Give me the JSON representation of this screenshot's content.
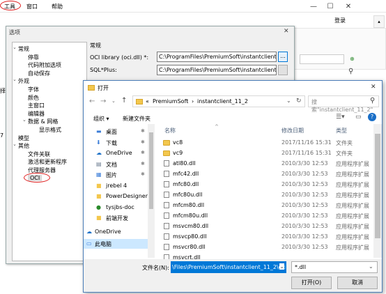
{
  "app": {
    "menu": [
      "工具",
      "窗口",
      "帮助"
    ],
    "login": "登录"
  },
  "options": {
    "title": "选项",
    "close": "✕",
    "section_title": "常规",
    "oci_label": "OCI library (oci.dll) *:",
    "oci_value": "C:\\ProgramFiles\\PremiumSoft\\instantclient_11",
    "sqlplus_label": "SQL*Plus:",
    "sqlplus_value": "C:\\ProgramFiles\\PremiumSoft\\instantclient_11_2",
    "browse": "...",
    "tree": [
      {
        "label": "常规",
        "level": 0,
        "expander": "⌄"
      },
      {
        "label": "停靠",
        "level": 1
      },
      {
        "label": "代码附加选项",
        "level": 1
      },
      {
        "label": "自动保存",
        "level": 1
      },
      {
        "label": "外观",
        "level": 0,
        "expander": "⌄"
      },
      {
        "label": "字体",
        "level": 1
      },
      {
        "label": "颜色",
        "level": 1
      },
      {
        "label": "主窗口",
        "level": 1
      },
      {
        "label": "编辑器",
        "level": 1
      },
      {
        "label": "数据 & 网格",
        "level": 1,
        "expander": "⌄"
      },
      {
        "label": "显示格式",
        "level": 2
      },
      {
        "label": "模型",
        "level": 0
      },
      {
        "label": "其他",
        "level": 0,
        "expander": "⌄"
      },
      {
        "label": "文件关联",
        "level": 1
      },
      {
        "label": "激活和更新程序",
        "level": 1
      },
      {
        "label": "代理服务器",
        "level": 1
      },
      {
        "label": "OCI",
        "level": 1,
        "selected": true
      }
    ]
  },
  "file_dialog": {
    "title": "打开",
    "close": "✕",
    "path": [
      "«",
      "PremiumSoft",
      "›",
      "instantclient_11_2"
    ],
    "search_placeholder": "搜索\"instantclient_11_2\"",
    "toolbar": {
      "organize": "组织 ▾",
      "new_folder": "新建文件夹"
    },
    "nav_items": [
      {
        "label": "桌面",
        "icon": "desktop-icon",
        "pinned": true
      },
      {
        "label": "下载",
        "icon": "download-icon",
        "pinned": true
      },
      {
        "label": "OneDrive",
        "icon": "onedrive-icon",
        "pinned": true
      },
      {
        "label": "文档",
        "icon": "documents-icon",
        "pinned": true
      },
      {
        "label": "图片",
        "icon": "pictures-icon",
        "pinned": true
      },
      {
        "label": "jrebel 4",
        "icon": "folder-icon"
      },
      {
        "label": "PowerDesigner",
        "icon": "folder-icon"
      },
      {
        "label": "tysjbs-doc",
        "icon": "app-icon"
      },
      {
        "label": "前端开发",
        "icon": "folder-icon"
      },
      {
        "label": "OneDrive",
        "icon": "onedrive-icon"
      },
      {
        "label": "此电脑",
        "icon": "pc-icon",
        "selected": true
      }
    ],
    "columns": {
      "name": "名称",
      "date": "修改日期",
      "type": "类型"
    },
    "files": [
      {
        "name": "vc8",
        "date": "2017/11/16 15:31",
        "type": "文件夹",
        "folder": true
      },
      {
        "name": "vc9",
        "date": "2017/11/16 15:31",
        "type": "文件夹",
        "folder": true
      },
      {
        "name": "atl80.dll",
        "date": "2010/3/30 12:53",
        "type": "应用程序扩展"
      },
      {
        "name": "mfc42.dll",
        "date": "2010/3/30 12:53",
        "type": "应用程序扩展"
      },
      {
        "name": "mfc80.dll",
        "date": "2010/3/30 12:53",
        "type": "应用程序扩展"
      },
      {
        "name": "mfc80u.dll",
        "date": "2010/3/30 12:53",
        "type": "应用程序扩展"
      },
      {
        "name": "mfcm80.dll",
        "date": "2010/3/30 12:53",
        "type": "应用程序扩展"
      },
      {
        "name": "mfcm80u.dll",
        "date": "2010/3/30 12:53",
        "type": "应用程序扩展"
      },
      {
        "name": "msvcm80.dll",
        "date": "2010/3/30 12:53",
        "type": "应用程序扩展"
      },
      {
        "name": "msvcp80.dll",
        "date": "2010/3/30 12:53",
        "type": "应用程序扩展"
      },
      {
        "name": "msvcr80.dll",
        "date": "2010/3/30 12:53",
        "type": "应用程序扩展"
      },
      {
        "name": "msvcrt.dll",
        "date": "",
        "type": ""
      }
    ],
    "filename_label": "文件名(N):",
    "filename_value": "\\Files\\PremiumSoft\\instantclient_11_2\\oci",
    "filter_value": "*.dll",
    "open_button": "打开(O)",
    "cancel_button": "取消"
  }
}
